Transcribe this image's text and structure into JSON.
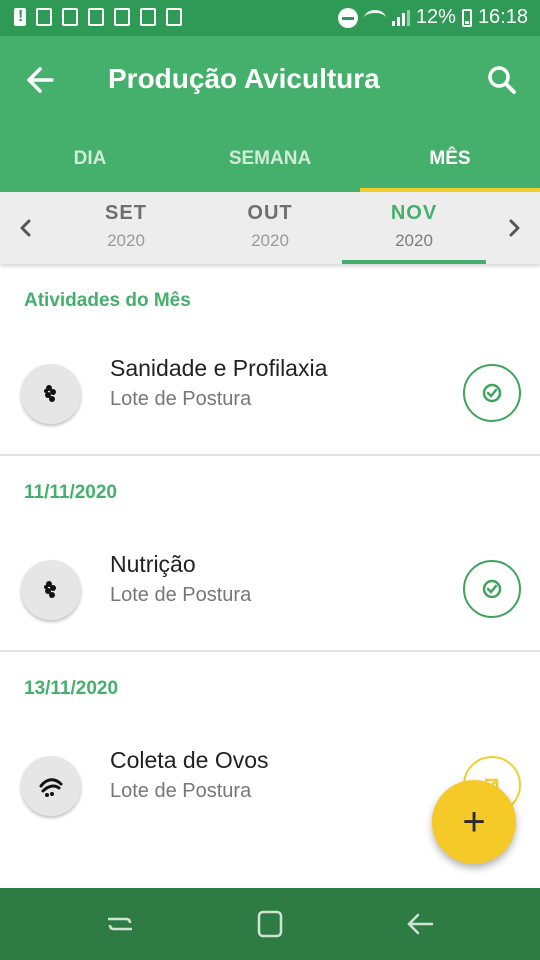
{
  "status_bar": {
    "battery_percent": "12%",
    "time": "16:18",
    "left_icons": [
      "alert-icon",
      "gmail-icon",
      "voicemail-icon",
      "lock-icon",
      "mm-icon",
      "image-icon",
      "laptop-icon"
    ],
    "right_icons": [
      "do-not-disturb-icon",
      "wifi-icon",
      "signal-icon",
      "battery-icon"
    ]
  },
  "app_bar": {
    "title": "Produção Avicultura",
    "back_icon": "arrow-back-icon",
    "search_icon": "search-icon",
    "tabs": [
      {
        "label": "DIA",
        "active": false
      },
      {
        "label": "SEMANA",
        "active": false
      },
      {
        "label": "MÊS",
        "active": true
      }
    ],
    "accent_color": "#45b06b",
    "tab_indicator_color": "#f3cf2c"
  },
  "month_selector": {
    "prev_icon": "chevron-left-icon",
    "next_icon": "chevron-right-icon",
    "months": [
      {
        "name": "SET",
        "year": "2020",
        "selected": false
      },
      {
        "name": "OUT",
        "year": "2020",
        "selected": false
      },
      {
        "name": "NOV",
        "year": "2020",
        "selected": true
      }
    ]
  },
  "sections": [
    {
      "header": "Atividades do Mês",
      "items": [
        {
          "title": "Sanidade e Profilaxia",
          "subtitle": "Lote de Postura",
          "icon": "virus-icon",
          "status": "done",
          "status_icon": "check-circle-icon"
        }
      ]
    },
    {
      "header": "11/11/2020",
      "items": [
        {
          "title": "Nutrição",
          "subtitle": "Lote de Postura",
          "icon": "grain-icon",
          "status": "done",
          "status_icon": "check-circle-icon"
        }
      ]
    },
    {
      "header": "13/11/2020",
      "items": [
        {
          "title": "Coleta de Ovos",
          "subtitle": "Lote de Postura",
          "icon": "hand-eggs-icon",
          "status": "pending",
          "status_icon": "open-arrow-icon"
        }
      ]
    }
  ],
  "fab": {
    "label": "+",
    "icon": "add-icon",
    "color": "#f5c928"
  },
  "nav_bar": {
    "buttons": [
      "recent-apps-icon",
      "home-icon",
      "back-nav-icon"
    ],
    "color": "#2e7c43"
  }
}
